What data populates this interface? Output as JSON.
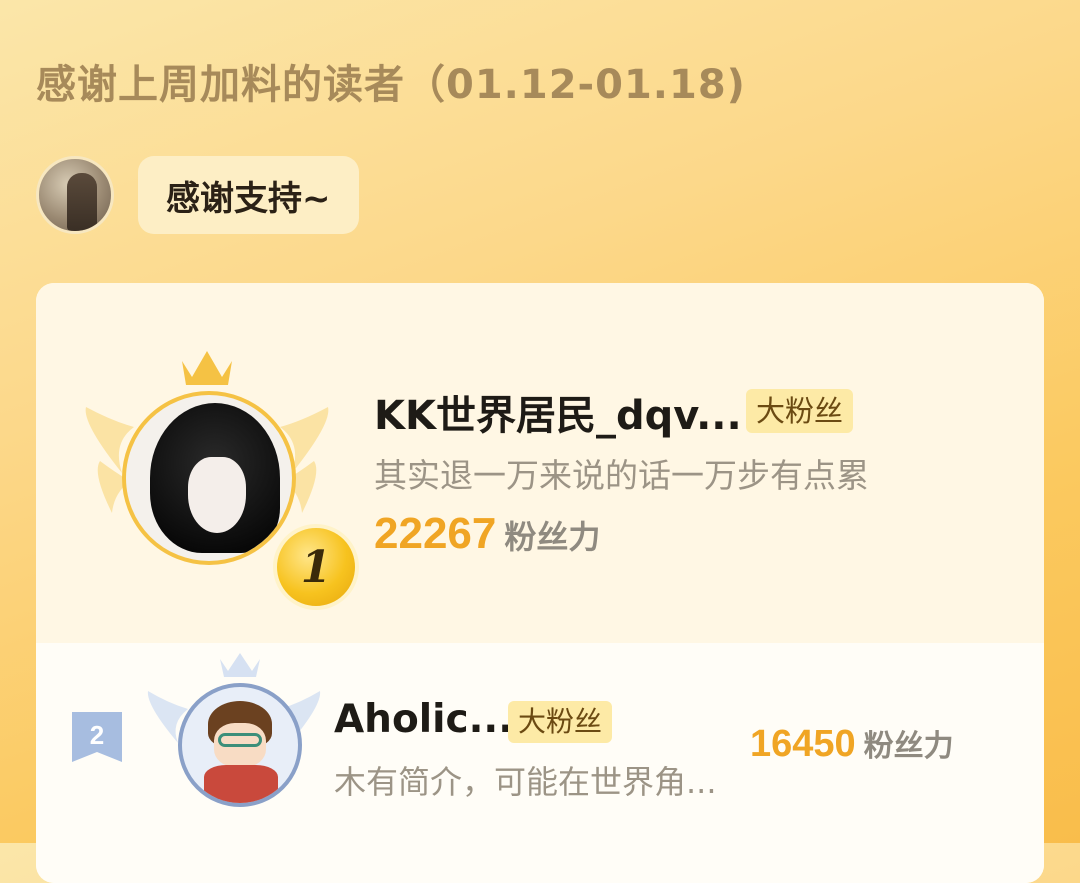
{
  "header": {
    "title": "感谢上周加料的读者（01.12-01.18)"
  },
  "author_message": {
    "text": "感谢支持~"
  },
  "ranking": [
    {
      "rank": "1",
      "name": "KK世界居民_dqv...",
      "badge": "大粉丝",
      "bio": "其实退一万来说的话一万步有点累",
      "score": "22267",
      "score_unit": "粉丝力"
    },
    {
      "rank": "2",
      "name": "Aholic...",
      "badge": "大粉丝",
      "bio": "木有简介，可能在世界角...",
      "score": "16450",
      "score_unit": "粉丝力"
    }
  ],
  "colors": {
    "gold": "#f5c244",
    "score": "#f0a524",
    "silver": "#8aa0c8",
    "badge_bg": "#fdeaa6"
  }
}
